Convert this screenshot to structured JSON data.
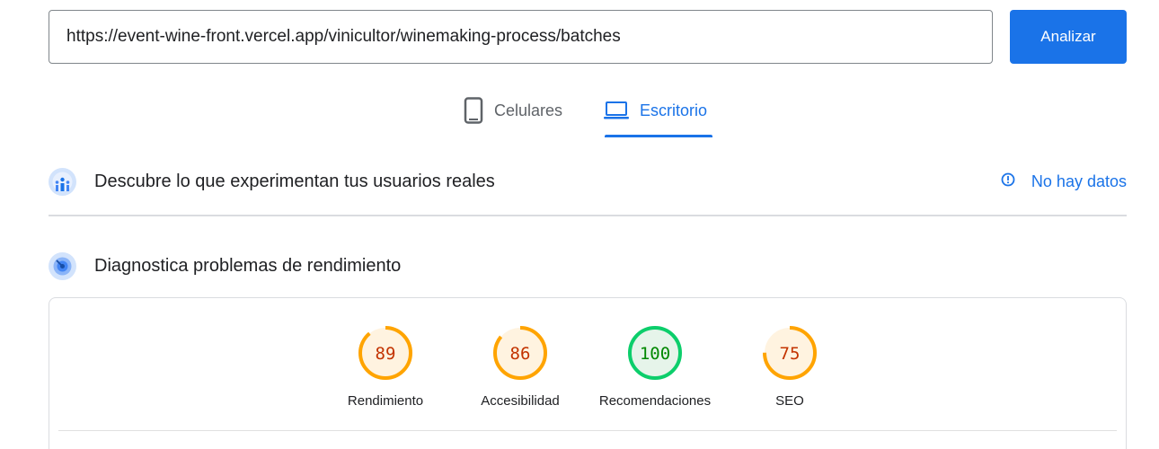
{
  "search": {
    "url": "https://event-wine-front.vercel.app/vinicultor/winemaking-process/batches",
    "analyze_label": "Analizar"
  },
  "tabs": [
    {
      "label": "Celulares",
      "icon": "smartphone-icon",
      "selected": false
    },
    {
      "label": "Escritorio",
      "icon": "laptop-icon",
      "selected": true
    }
  ],
  "field_data": {
    "title": "Descubre lo que experimentan tus usuarios reales",
    "status_label": "No hay datos",
    "icon": "users-chart-icon",
    "status_icon": "info-icon"
  },
  "lab_data": {
    "title": "Diagnostica problemas de rendimiento",
    "icon": "diagnostic-icon"
  },
  "scores": [
    {
      "label": "Rendimiento",
      "value": 89,
      "color": "#ffa400",
      "text_color": "#c33300",
      "bg": "#fff3e0"
    },
    {
      "label": "Accesibilidad",
      "value": 86,
      "color": "#ffa400",
      "text_color": "#c33300",
      "bg": "#fff3e0"
    },
    {
      "label": "Recomendaciones",
      "value": 100,
      "color": "#0cce6b",
      "text_color": "#008800",
      "bg": "#e6f4ea"
    },
    {
      "label": "SEO",
      "value": 75,
      "color": "#ffa400",
      "text_color": "#c33300",
      "bg": "#fff3e0"
    }
  ],
  "colors": {
    "accent": "#1a73e8",
    "border": "#dadce0"
  }
}
